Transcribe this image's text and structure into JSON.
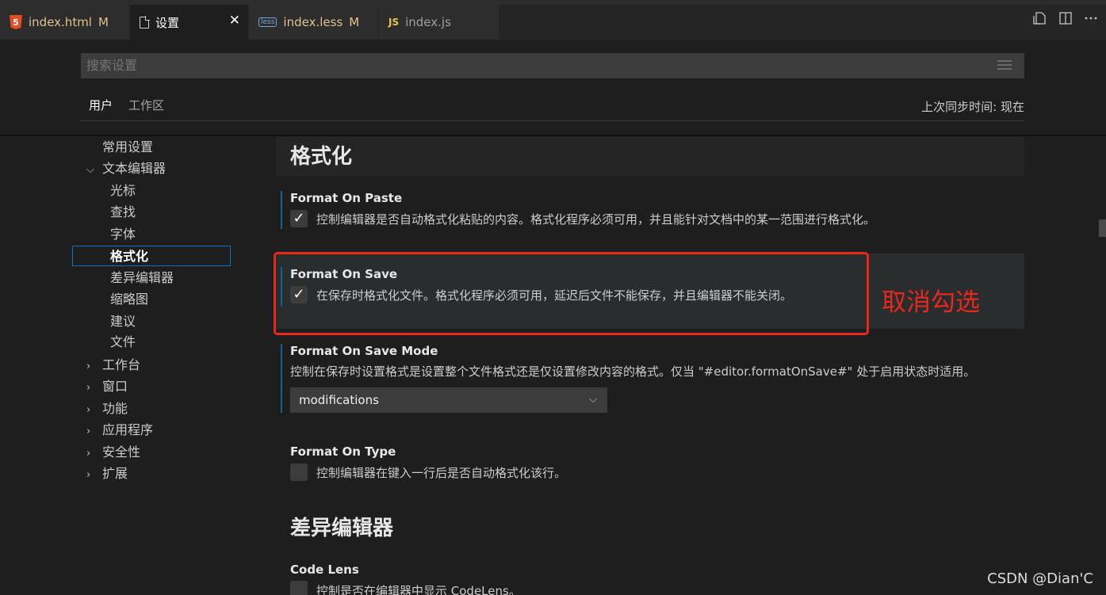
{
  "tabs": [
    {
      "label": "index.html",
      "modified": "M",
      "icon": "html5-icon"
    },
    {
      "label": "设置",
      "icon": "file-icon",
      "close": "✕"
    },
    {
      "label": "index.less",
      "modified": "M",
      "icon": "less-icon",
      "icon_text": "less"
    },
    {
      "label": "index.js",
      "icon": "js-icon",
      "icon_text": "JS"
    }
  ],
  "search": {
    "placeholder": "搜索设置"
  },
  "scope_tabs": {
    "user": "用户",
    "workspace": "工作区"
  },
  "sync_status": "上次同步时间: 现在",
  "toc": {
    "common": "常用设置",
    "text_editor": "文本编辑器",
    "cursor": "光标",
    "find": "查找",
    "font": "字体",
    "formatting": "格式化",
    "diff_editor": "差异编辑器",
    "minimap": "缩略图",
    "suggestions": "建议",
    "files": "文件",
    "workbench": "工作台",
    "window": "窗口",
    "features": "功能",
    "application": "应用程序",
    "security": "安全性",
    "extensions": "扩展"
  },
  "section_title": "格式化",
  "settings": {
    "format_on_paste": {
      "label": "Format On Paste",
      "desc": "控制编辑器是否自动格式化粘贴的内容。格式化程序必须可用，并且能针对文档中的某一范围进行格式化。",
      "checked": true
    },
    "format_on_save": {
      "label": "Format On Save",
      "desc": "在保存时格式化文件。格式化程序必须可用，延迟后文件不能保存，并且编辑器不能关闭。",
      "checked": true
    },
    "format_on_save_mode": {
      "label": "Format On Save Mode",
      "desc": "控制在保存时设置格式是设置整个文件格式还是仅设置修改内容的格式。仅当 \"#editor.formatOnSave#\" 处于启用状态时适用。",
      "value": "modifications"
    },
    "format_on_type": {
      "label": "Format On Type",
      "desc": "控制编辑器在键入一行后是否自动格式化该行。",
      "checked": false
    },
    "code_lens": {
      "label": "Code Lens",
      "desc": "控制是否在编辑器中显示 CodeLens。",
      "checked": false
    }
  },
  "section_title_2": "差异编辑器",
  "annotation": {
    "text": "取消勾选",
    "color": "#e8281e"
  },
  "watermark": "CSDN @Dian'C",
  "colors": {
    "accent": "#0e639c",
    "background": "#1e1e1e"
  }
}
